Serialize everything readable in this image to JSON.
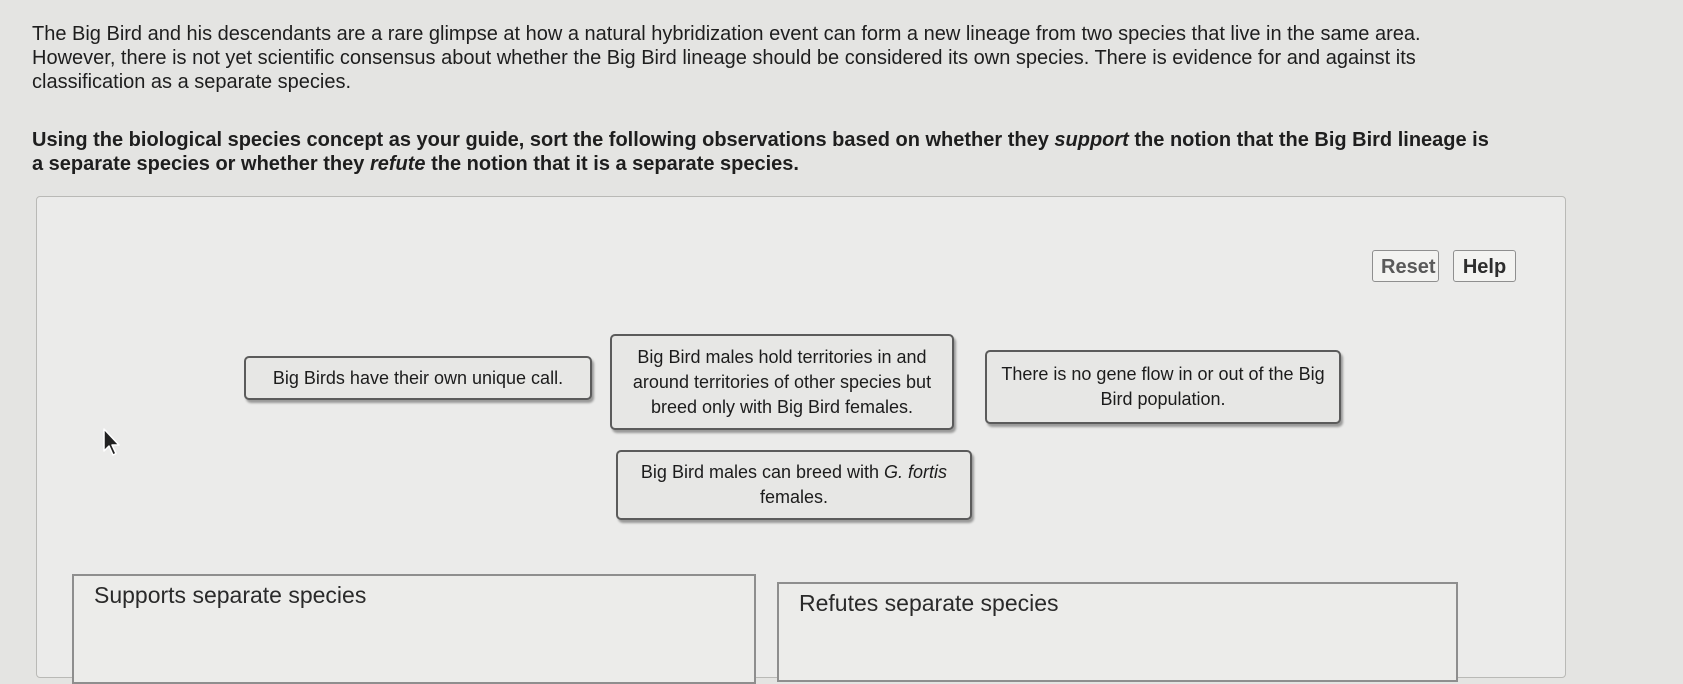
{
  "intro": {
    "line1": "The Big Bird and his descendants are a rare glimpse at how a natural hybridization event can form a new lineage from two species that live in the same area.",
    "line2": "However, there is not yet scientific consensus about whether the Big Bird lineage should be considered its own species. There is evidence for and against its",
    "line3": "classification as a separate species."
  },
  "instructions": {
    "part1": "Using the biological species concept as your guide, sort the following observations based on whether they ",
    "support": "support",
    "part2": " the notion that the Big Bird lineage is",
    "part3": "a separate species or whether they ",
    "refute": "refute",
    "part4": " the notion that it is a separate species."
  },
  "toolbar": {
    "reset_label": "Reset",
    "help_label": "Help"
  },
  "cards": [
    {
      "text": "Big Birds have their own unique call."
    },
    {
      "text": "Big Bird males hold territories in and around territories of other species but breed only with Big Bird females."
    },
    {
      "text": "There is no gene flow in or out of the Big Bird population."
    },
    {
      "text_before": "Big Bird males can breed with ",
      "text_italic": "G. fortis",
      "text_after": " females."
    }
  ],
  "drop_zones": {
    "supports": {
      "label": "Supports separate species"
    },
    "refutes": {
      "label": "Refutes separate species"
    }
  },
  "icons": {
    "cursor": "mouse-pointer-icon"
  }
}
